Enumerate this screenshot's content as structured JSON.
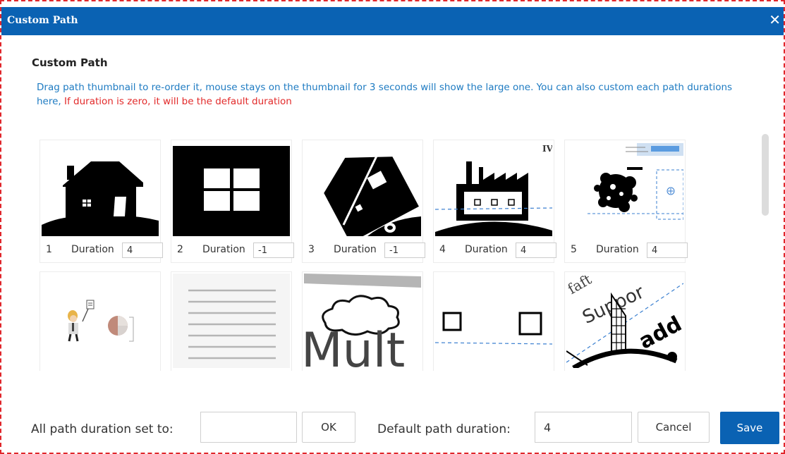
{
  "window": {
    "title": "Custom Path",
    "close_glyph": "✕"
  },
  "heading": "Custom Path",
  "description": {
    "main": "Drag path thumbnail to re-order it, mouse stays on the thumbnail for 3 seconds will show the large one. You can also custom each path durations here, ",
    "warning": "If duration is zero, it will be the default duration"
  },
  "duration_label": "Duration",
  "paths": [
    {
      "number": "1",
      "duration": "4",
      "thumbnail": "house-icon"
    },
    {
      "number": "2",
      "duration": "-1",
      "thumbnail": "window-icon"
    },
    {
      "number": "3",
      "duration": "-1",
      "thumbnail": "tilted-house-icon"
    },
    {
      "number": "4",
      "duration": "4",
      "thumbnail": "factory-icon"
    },
    {
      "number": "5",
      "duration": "4",
      "thumbnail": "cluster-icon"
    },
    {
      "thumbnail": "businessman-icon"
    },
    {
      "thumbnail": "lines-icon"
    },
    {
      "thumbnail": "cloud-text-icon"
    },
    {
      "thumbnail": "squares-icon"
    },
    {
      "thumbnail": "building-text-icon"
    }
  ],
  "thumbnail_text": {
    "factory_corner": "IV",
    "cloud_word": "Mult",
    "curve_word1": "Suppor",
    "curve_word2": "add t",
    "curve_word3": "faft"
  },
  "footer": {
    "all_duration_label": "All path duration set to:",
    "all_duration_value": "",
    "ok_label": "OK",
    "default_duration_label": "Default path duration:",
    "default_duration_value": "4",
    "cancel_label": "Cancel",
    "save_label": "Save"
  },
  "colors": {
    "titlebar": "#0a62b3",
    "description": "#1e7bc2",
    "warning": "#e22a2a",
    "dashed_border": "#e0262b"
  }
}
